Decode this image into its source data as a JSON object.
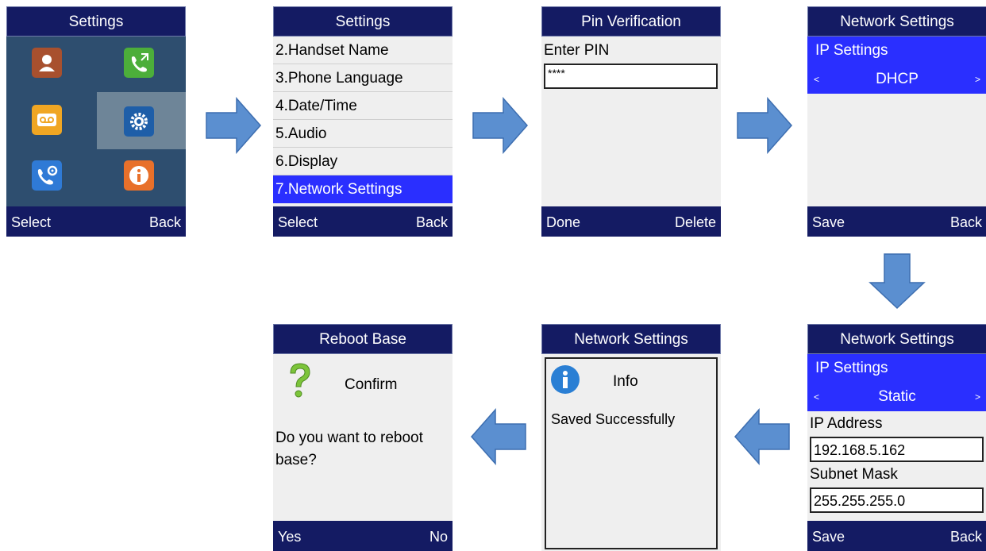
{
  "screens": {
    "menu": {
      "title": "Settings",
      "softkey_left": "Select",
      "softkey_right": "Back",
      "icons": [
        "contacts-icon",
        "call-history-icon",
        "voicemail-icon",
        "settings-gear-icon",
        "call-settings-icon",
        "info-icon"
      ]
    },
    "settings_list": {
      "title": "Settings",
      "items": [
        "2.Handset Name",
        "3.Phone Language",
        "4.Date/Time",
        "5.Audio",
        "6.Display",
        "7.Network Settings"
      ],
      "selected_index": 5,
      "softkey_left": "Select",
      "softkey_right": "Back"
    },
    "pin": {
      "title": "Pin Verification",
      "prompt": "Enter PIN",
      "pin_value": "****",
      "softkey_left": "Done",
      "softkey_right": "Delete"
    },
    "network_dhcp": {
      "title": "Network Settings",
      "section": "IP Settings",
      "left_arrow": "<",
      "mode": "DHCP",
      "right_arrow": ">",
      "softkey_left": "Save",
      "softkey_right": "Back"
    },
    "network_static": {
      "title": "Network Settings",
      "section": "IP Settings",
      "left_arrow": "<",
      "mode": "Static",
      "right_arrow": ">",
      "ip_label": "IP Address",
      "ip_value": "192.168.5.162",
      "mask_label": "Subnet Mask",
      "mask_value": "255.255.255.0",
      "softkey_left": "Save",
      "softkey_right": "Back"
    },
    "info": {
      "title": "Network Settings",
      "header": "Info",
      "message": "Saved Successfully"
    },
    "reboot": {
      "title": "Reboot Base",
      "header": "Confirm",
      "question": "Do you want to reboot base?",
      "softkey_left": "Yes",
      "softkey_right": "No"
    }
  },
  "colors": {
    "bar": "#141b63",
    "highlight": "#2a2fff",
    "arrow": "#5b8fd0",
    "screen_bg": "#efefef",
    "menu_bg": "#2d4d6e"
  }
}
